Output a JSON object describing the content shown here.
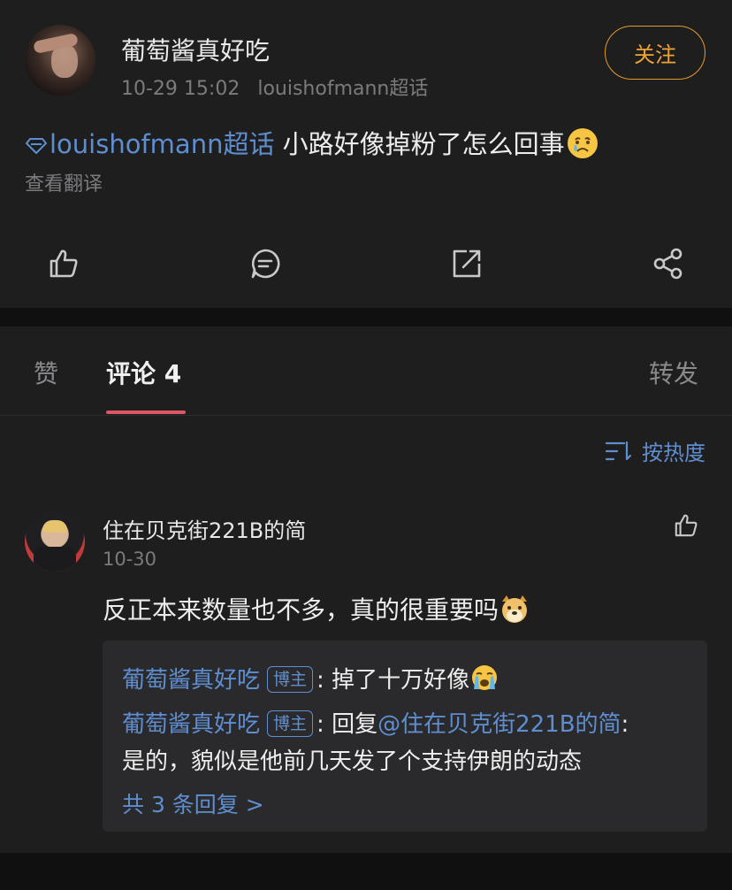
{
  "post": {
    "author": "葡萄酱真好吃",
    "date": "10-29 15:02",
    "source": "louishofmann超话",
    "follow_label": "关注",
    "topic": "louishofmann超话",
    "text": " 小路好像掉粉了怎么回事",
    "emoji": "crying-face",
    "translate_label": "查看翻译",
    "actions": [
      "like-icon",
      "comment-icon",
      "repost-icon",
      "share-icon"
    ]
  },
  "tabs": {
    "like_label": "赞",
    "comment_label": "评论 4",
    "repost_label": "转发"
  },
  "sort": {
    "label": "按热度"
  },
  "comment": {
    "author": "住在贝克街221B的简",
    "date": "10-30",
    "text": "反正本来数量也不多，真的很重要吗",
    "emoji": "doge",
    "replies": [
      {
        "author": "葡萄酱真好吃",
        "badge": "博主",
        "colon": ": ",
        "text": "掉了十万好像",
        "emoji": "loudly-crying-face"
      },
      {
        "author": "葡萄酱真好吃",
        "badge": "博主",
        "colon": ": ",
        "prefix": "回复",
        "mention": "@住在贝克街221B的简",
        "mention_colon": ":",
        "text": "是的，貌似是他前几天发了个支持伊朗的动态"
      }
    ],
    "more_label": "共 3 条回复 >"
  },
  "colors": {
    "accent_blue": "#5f8ed0",
    "follow_orange": "#f0a435",
    "tab_underline": "#e05563",
    "panel_bg": "#1e1e1f",
    "page_bg": "#101010"
  }
}
